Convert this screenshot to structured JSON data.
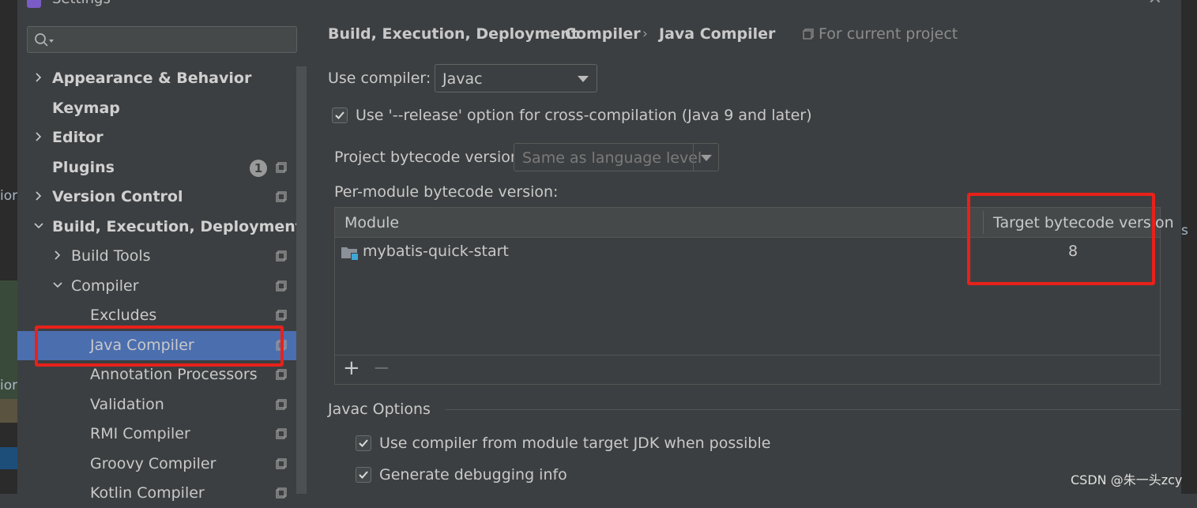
{
  "window": {
    "title": "Settings"
  },
  "background": {
    "left_text_1": "ior",
    "left_text_2": "ior",
    "right_text": "s"
  },
  "search": {
    "placeholder": ""
  },
  "tree": [
    {
      "label": "Appearance & Behavior",
      "bold": true,
      "arrow": "right",
      "indent": 0
    },
    {
      "label": "Keymap",
      "bold": true,
      "arrow": "none",
      "indent": 0
    },
    {
      "label": "Editor",
      "bold": true,
      "arrow": "right",
      "indent": 0
    },
    {
      "label": "Plugins",
      "bold": true,
      "arrow": "none",
      "indent": 0,
      "badge": "1",
      "copy": true
    },
    {
      "label": "Version Control",
      "bold": true,
      "arrow": "right",
      "indent": 0,
      "copy": true
    },
    {
      "label": "Build, Execution, Deployment",
      "bold": true,
      "arrow": "down",
      "indent": 0
    },
    {
      "label": "Build Tools",
      "bold": false,
      "arrow": "right",
      "indent": 1,
      "copy": true
    },
    {
      "label": "Compiler",
      "bold": false,
      "arrow": "down",
      "indent": 1,
      "copy": true
    },
    {
      "label": "Excludes",
      "bold": false,
      "arrow": "none",
      "indent": 2,
      "copy": true
    },
    {
      "label": "Java Compiler",
      "bold": false,
      "arrow": "none",
      "indent": 2,
      "copy": true,
      "selected": true
    },
    {
      "label": "Annotation Processors",
      "bold": false,
      "arrow": "none",
      "indent": 2,
      "copy": true
    },
    {
      "label": "Validation",
      "bold": false,
      "arrow": "none",
      "indent": 2,
      "copy": true
    },
    {
      "label": "RMI Compiler",
      "bold": false,
      "arrow": "none",
      "indent": 2,
      "copy": true
    },
    {
      "label": "Groovy Compiler",
      "bold": false,
      "arrow": "none",
      "indent": 2,
      "copy": true
    },
    {
      "label": "Kotlin Compiler",
      "bold": false,
      "arrow": "none",
      "indent": 2,
      "copy": true
    }
  ],
  "breadcrumb": {
    "items": [
      "Build, Execution, Deployment",
      "Compiler",
      "Java Compiler"
    ],
    "scope": "For current project"
  },
  "compiler": {
    "label": "Use compiler:",
    "value": "Javac"
  },
  "release_option": {
    "label": "Use '--release' option for cross-compilation (Java 9 and later)",
    "checked": true
  },
  "project_bytecode": {
    "label": "Project bytecode version:",
    "value": "Same as language level"
  },
  "per_module": {
    "label": "Per-module bytecode version:",
    "columns": [
      "Module",
      "Target bytecode version"
    ],
    "rows": [
      {
        "module": "mybatis-quick-start",
        "target": "8"
      }
    ],
    "add_label": "+",
    "remove_label": "−"
  },
  "javac_options": {
    "title": "Javac Options",
    "options": [
      {
        "label": "Use compiler from module target JDK when possible",
        "checked": true
      },
      {
        "label": "Generate debugging info",
        "checked": true
      }
    ]
  },
  "watermark": "CSDN @朱一头zcy",
  "colors": {
    "selection": "#4b6eaf",
    "highlight": "#e8211b",
    "background": "#3c3f41"
  }
}
